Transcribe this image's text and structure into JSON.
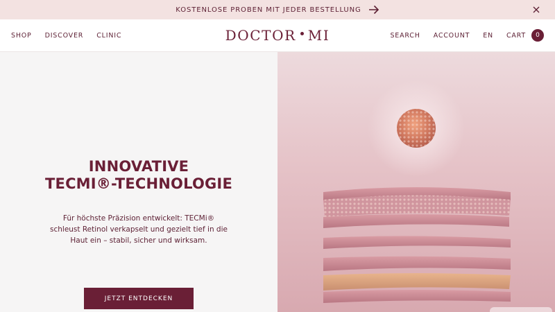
{
  "promo": {
    "text": "KOSTENLOSE PROBEN MIT JEDER BESTELLUNG",
    "arrow_icon": "arrow-right-icon",
    "close_icon": "close-icon"
  },
  "nav": {
    "left": [
      "SHOP",
      "DISCOVER",
      "CLINIC"
    ],
    "logo_left": "DOCTOR",
    "logo_right": "MI",
    "search": "SEARCH",
    "account": "ACCOUNT",
    "language": "EN",
    "cart": "CART",
    "cart_count": "0"
  },
  "hero": {
    "title_line1": "INNOVATIVE",
    "title_line2": "TECMI®-TECHNOLOGIE",
    "body_line1": "Für höchste Präzision entwickelt: TECMi®",
    "body_line2": "schleust Retinol verkapselt und gezielt tief in die",
    "body_line3": "Haut ein – stabil, sicher und wirksam.",
    "cta": "JETZT ENTDECKEN",
    "image": "skin-layers-capsule-illustration"
  },
  "colors": {
    "brand": "#6a1f36",
    "promo_bg": "#f3e2e1",
    "hero_left_bg": "#f6f5f5",
    "hero_right_bg": "#e5c2c7"
  }
}
